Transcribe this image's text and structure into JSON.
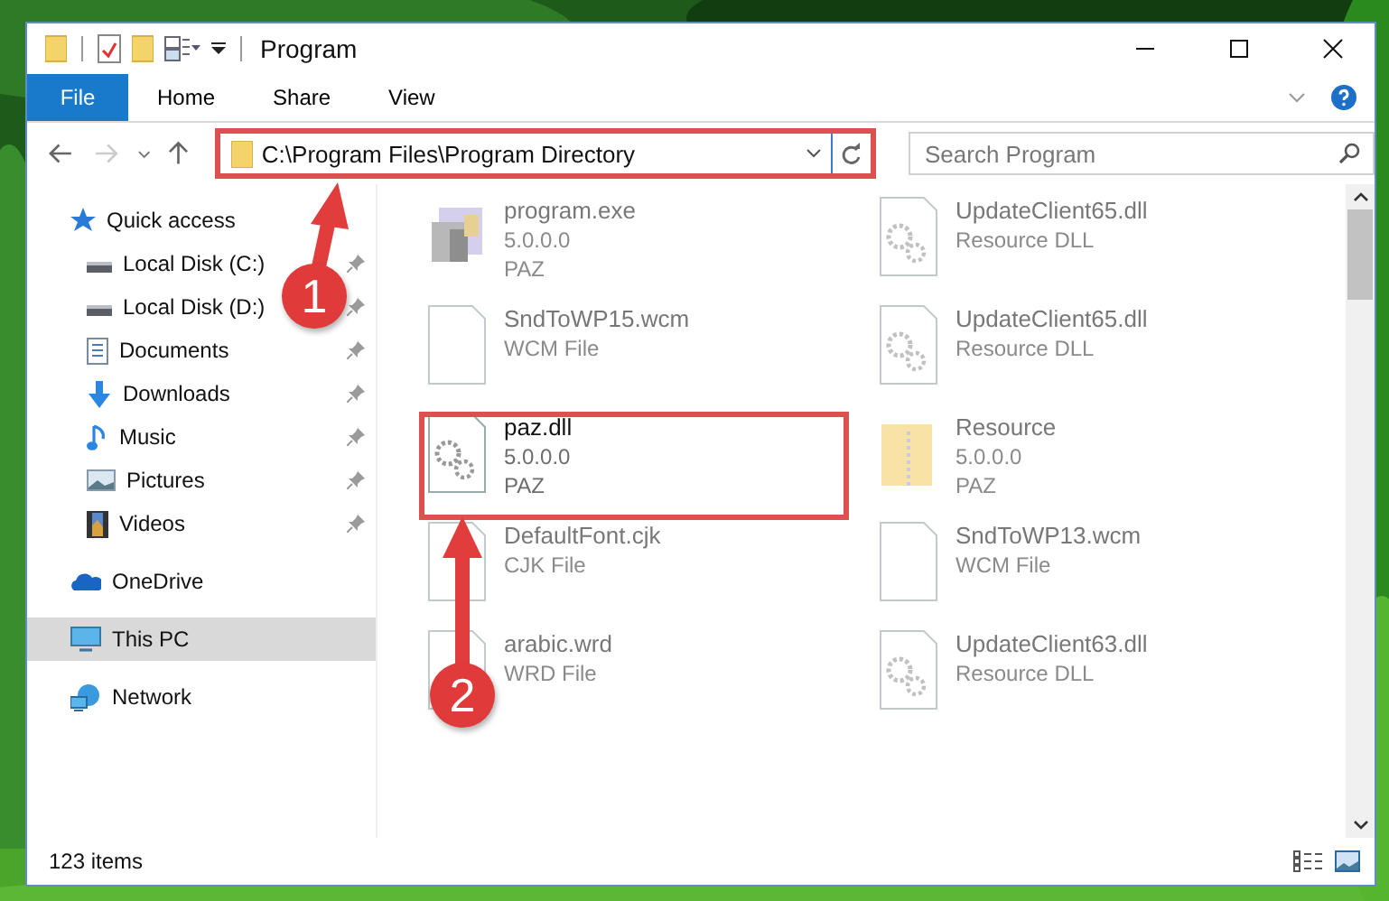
{
  "window": {
    "title": "Program"
  },
  "ribbon_tabs": [
    {
      "label": "File",
      "selected": true
    },
    {
      "label": "Home",
      "selected": false
    },
    {
      "label": "Share",
      "selected": false
    },
    {
      "label": "View",
      "selected": false
    }
  ],
  "address": {
    "path": "C:\\Program Files\\Program Directory"
  },
  "search": {
    "placeholder": "Search Program"
  },
  "sidebar": {
    "items": [
      {
        "label": "Quick access",
        "kind": "star",
        "pinned": false,
        "selected": false,
        "children": [
          {
            "label": "Local Disk (C:)",
            "kind": "drive",
            "pinned": true,
            "selected": false
          },
          {
            "label": "Local Disk (D:)",
            "kind": "drive",
            "pinned": true,
            "selected": false
          },
          {
            "label": "Documents",
            "kind": "documents",
            "pinned": true,
            "selected": false
          },
          {
            "label": "Downloads",
            "kind": "downloads",
            "pinned": true,
            "selected": false
          },
          {
            "label": "Music",
            "kind": "music",
            "pinned": true,
            "selected": false
          },
          {
            "label": "Pictures",
            "kind": "pictures",
            "pinned": true,
            "selected": false
          },
          {
            "label": "Videos",
            "kind": "videos",
            "pinned": true,
            "selected": false
          }
        ]
      },
      {
        "label": "OneDrive",
        "kind": "cloud",
        "pinned": false,
        "selected": false
      },
      {
        "label": "This PC",
        "kind": "computer",
        "pinned": false,
        "selected": true
      },
      {
        "label": "Network",
        "kind": "network",
        "pinned": false,
        "selected": false
      }
    ]
  },
  "files": [
    {
      "name": "program.exe",
      "details": [
        "5.0.0.0",
        "PAZ"
      ],
      "kind": "exe",
      "faded": true
    },
    {
      "name": "UpdateClient65.dll",
      "details": [
        "Resource DLL"
      ],
      "kind": "dll",
      "faded": true
    },
    {
      "name": "SndToWP15.wcm",
      "details": [
        "WCM File"
      ],
      "kind": "file",
      "faded": true
    },
    {
      "name": "UpdateClient65.dll",
      "details": [
        "Resource DLL"
      ],
      "kind": "dll",
      "faded": true
    },
    {
      "name": "paz.dll",
      "details": [
        "5.0.0.0",
        "PAZ"
      ],
      "kind": "dll",
      "faded": false
    },
    {
      "name": "Resource",
      "details": [
        "5.0.0.0",
        "PAZ"
      ],
      "kind": "folder",
      "faded": true
    },
    {
      "name": "DefaultFont.cjk",
      "details": [
        "CJK File"
      ],
      "kind": "file",
      "faded": true
    },
    {
      "name": "SndToWP13.wcm",
      "details": [
        "WCM File"
      ],
      "kind": "file",
      "faded": true
    },
    {
      "name": "arabic.wrd",
      "details": [
        "WRD File"
      ],
      "kind": "file",
      "faded": true
    },
    {
      "name": "UpdateClient63.dll",
      "details": [
        "Resource DLL"
      ],
      "kind": "dll",
      "faded": true
    }
  ],
  "status_bar": {
    "count": "123 items"
  },
  "annotations": [
    {
      "number": "1"
    },
    {
      "number": "2"
    }
  ]
}
